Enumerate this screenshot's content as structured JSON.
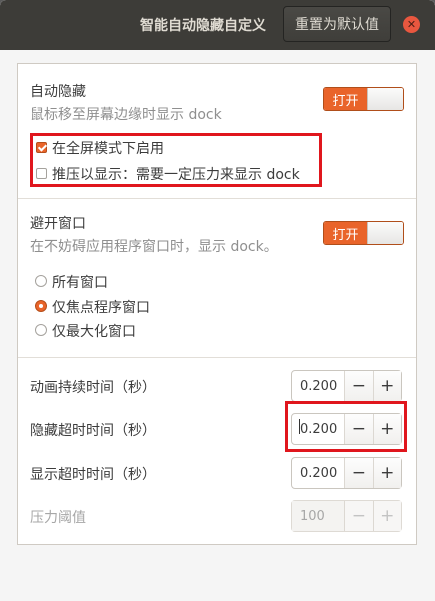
{
  "window": {
    "title": "智能自动隐藏自定义",
    "reset_label": "重置为默认值",
    "close_glyph": "✕"
  },
  "autohide": {
    "title": "自动隐藏",
    "subtitle": "鼠标移至屏幕边缘时显示 dock",
    "switch_label": "打开",
    "fullscreen_label": "在全屏模式下启用",
    "fullscreen_checked": true,
    "pressure_label": "推压以显示：需要一定压力来显示 dock",
    "pressure_checked": false
  },
  "intellihide": {
    "title": "避开窗口",
    "subtitle": "在不妨碍应用程序窗口时，显示 dock。",
    "switch_label": "打开",
    "options": [
      {
        "label": "所有窗口",
        "selected": false
      },
      {
        "label": "仅焦点程序窗口",
        "selected": true
      },
      {
        "label": "仅最大化窗口",
        "selected": false
      }
    ]
  },
  "timings": {
    "animation": {
      "label": "动画持续时间（秒）",
      "value": "0.200"
    },
    "hide": {
      "label": "隐藏超时时间（秒）",
      "value": "0.200"
    },
    "show": {
      "label": "显示超时时间（秒）",
      "value": "0.200"
    },
    "pressure": {
      "label": "压力阈值",
      "value": "100",
      "disabled": true
    },
    "minus": "−",
    "plus": "+"
  },
  "colors": {
    "accent": "#e9642a",
    "highlight": "#e0161d",
    "titlebar": "#3d3c38"
  }
}
